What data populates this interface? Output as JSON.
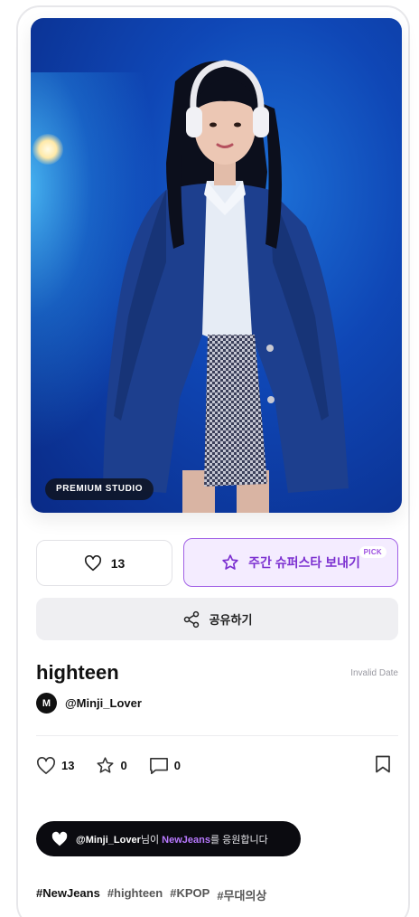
{
  "photo": {
    "badge": "PREMIUM STUDIO"
  },
  "actions": {
    "like_count": "13",
    "pick_label": "주간 슈퍼스타 보내기",
    "pick_tag": "PICK",
    "share_label": "공유하기"
  },
  "post": {
    "title": "highteen",
    "date": "Invalid Date",
    "author_initial": "M",
    "author_name": "@Minji_Lover"
  },
  "stats": {
    "likes": "13",
    "stars": "0",
    "comments": "0"
  },
  "cheer": {
    "user": "@Minji_Lover",
    "mid": "님이 ",
    "group": "NewJeans",
    "end": "를 응원합니다"
  },
  "tags": [
    "#NewJeans",
    "#highteen",
    "#KPOP",
    "#무대의상"
  ],
  "colors": {
    "accent": "#7b2fd0",
    "accent_bg": "#f4ecff",
    "cheer_bg": "#0b0b10",
    "highlight": "#b879ff"
  }
}
